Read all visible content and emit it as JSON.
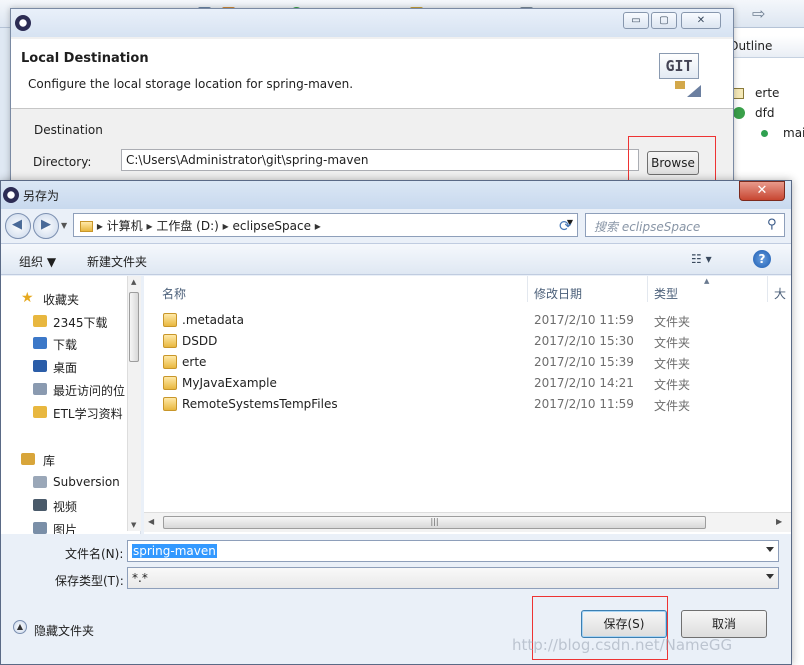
{
  "outline": {
    "tab_label": "Outline",
    "rows": [
      "erte",
      "dfd",
      "mai"
    ]
  },
  "wizard": {
    "header_title": "Local Destination",
    "header_desc": "Configure the local storage location for spring-maven.",
    "git_logo_text": "GIT",
    "destination_label": "Destination",
    "directory_label": "Directory:",
    "directory_value": "C:\\Users\\Administrator\\git\\spring-maven",
    "browse_label": "Browse",
    "btn_min": "▭",
    "btn_max": "▢",
    "btn_close": "✕"
  },
  "save_dialog": {
    "title": "另存为",
    "close": "✕",
    "address": [
      "计算机",
      "工作盘 (D:)",
      "eclipseSpace"
    ],
    "search_placeholder": "搜索 eclipseSpace",
    "organize": "组织 ▼",
    "new_folder": "新建文件夹",
    "nav": [
      {
        "label": "收藏夹",
        "color": "#e6a91f"
      },
      {
        "label": "2345下载",
        "color": "#e8b73f"
      },
      {
        "label": "下载",
        "color": "#3c78c8"
      },
      {
        "label": "桌面",
        "color": "#2b5da8"
      },
      {
        "label": "最近访问的位",
        "color": "#8a9ab0"
      },
      {
        "label": "ETL学习资料",
        "color": "#e8b73f"
      },
      {
        "label": "库",
        "color": "#d8a53a"
      },
      {
        "label": "Subversion",
        "color": "#9aa7b8"
      },
      {
        "label": "视频",
        "color": "#4a5a6a"
      },
      {
        "label": "图片",
        "color": "#7a8fa8"
      }
    ],
    "columns": {
      "name": "名称",
      "date": "修改日期",
      "type": "类型",
      "size": "大"
    },
    "files": [
      {
        "name": ".metadata",
        "date": "2017/2/10 11:59",
        "type": "文件夹"
      },
      {
        "name": "DSDD",
        "date": "2017/2/10 15:30",
        "type": "文件夹"
      },
      {
        "name": "erte",
        "date": "2017/2/10 15:39",
        "type": "文件夹"
      },
      {
        "name": "MyJavaExample",
        "date": "2017/2/10 14:21",
        "type": "文件夹"
      },
      {
        "name": "RemoteSystemsTempFiles",
        "date": "2017/2/10 11:59",
        "type": "文件夹"
      }
    ],
    "filename_label": "文件名(N):",
    "filename_value": "spring-maven",
    "filetype_label": "保存类型(T):",
    "filetype_value": "*.*",
    "hide_folders": "隐藏文件夹",
    "save_btn": "保存(S)",
    "cancel_btn": "取消"
  },
  "watermark": "http://blog.csdn.net/NameGG"
}
